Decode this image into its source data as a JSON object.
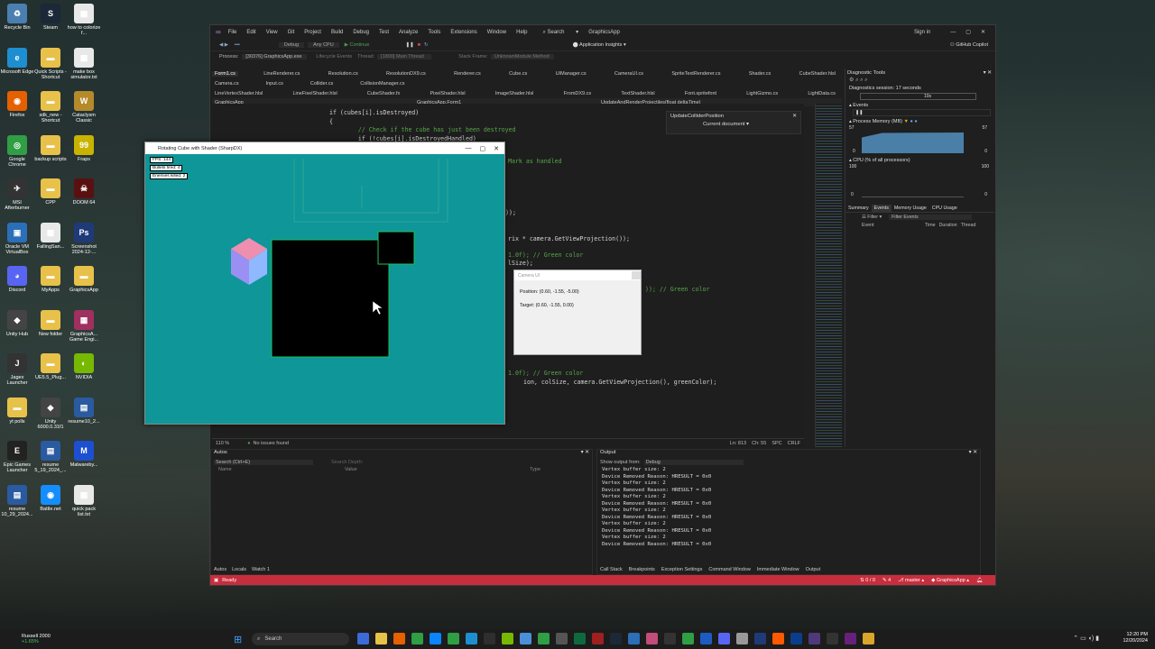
{
  "desktop": {
    "icons": [
      {
        "label": "Recycle Bin",
        "color": "#4a7fb0",
        "glyph": "♻"
      },
      {
        "label": "Steam",
        "color": "#1b2838",
        "glyph": "S"
      },
      {
        "label": "how to colorize f...",
        "color": "#e8e8e8",
        "glyph": "▦"
      },
      {
        "label": "Microsoft Edge",
        "color": "#1d8fd1",
        "glyph": "e"
      },
      {
        "label": "Quick Scripts - Shortcut",
        "color": "#e8c14a",
        "glyph": "▬"
      },
      {
        "label": "make box simulator.txt",
        "color": "#e8e8e8",
        "glyph": "▦"
      },
      {
        "label": "Firefox",
        "color": "#e66000",
        "glyph": "◉"
      },
      {
        "label": "sdk_new - Shortcut",
        "color": "#e8c14a",
        "glyph": "▬"
      },
      {
        "label": "Cataclysm Classic",
        "color": "#b58a2a",
        "glyph": "W"
      },
      {
        "label": "Google Chrome",
        "color": "#2f9e44",
        "glyph": "◎"
      },
      {
        "label": "backup scripts",
        "color": "#e8c14a",
        "glyph": "▬"
      },
      {
        "label": "Fraps",
        "color": "#c8b400",
        "glyph": "99"
      },
      {
        "label": "MSI Afterburner",
        "color": "#333",
        "glyph": "✈"
      },
      {
        "label": "CPP",
        "color": "#e8c14a",
        "glyph": "▬"
      },
      {
        "label": "DOOM 64",
        "color": "#5a1010",
        "glyph": "☠"
      },
      {
        "label": "Oracle VM VirtualBox",
        "color": "#2a6fb8",
        "glyph": "▣"
      },
      {
        "label": "FallingSan...",
        "color": "#e8e8e8",
        "glyph": "▦"
      },
      {
        "label": "Screenshot 2024-12-...",
        "color": "#1e3a78",
        "glyph": "Ps"
      },
      {
        "label": "Discord",
        "color": "#5865f2",
        "glyph": "◕"
      },
      {
        "label": "MyApps",
        "color": "#e8c14a",
        "glyph": "▬"
      },
      {
        "label": "GraphicsApp",
        "color": "#e8c14a",
        "glyph": "▬"
      },
      {
        "label": "Unity Hub",
        "color": "#444",
        "glyph": "◆"
      },
      {
        "label": "New folder",
        "color": "#e8c14a",
        "glyph": "▬"
      },
      {
        "label": "GraphicsA... Game Engi...",
        "color": "#a03060",
        "glyph": "▦"
      },
      {
        "label": "Jagex Launcher",
        "color": "#333",
        "glyph": "J"
      },
      {
        "label": "UE5.5_Plug...",
        "color": "#e8c14a",
        "glyph": "▬"
      },
      {
        "label": "NVIDIA",
        "color": "#76b900",
        "glyph": "◐"
      },
      {
        "label": "yt polls",
        "color": "#e8c14a",
        "glyph": "▬"
      },
      {
        "label": "Unity 6000.0.31f1",
        "color": "#444",
        "glyph": "◆"
      },
      {
        "label": "resume10_2...",
        "color": "#2a5aa0",
        "glyph": "▤"
      },
      {
        "label": "Epic Games Launcher",
        "color": "#222",
        "glyph": "E"
      },
      {
        "label": "resume 5_19_2024_...",
        "color": "#2a5aa0",
        "glyph": "▤"
      },
      {
        "label": "Malwareby...",
        "color": "#1d4fd1",
        "glyph": "M"
      },
      {
        "label": "resume 10_29_2024...",
        "color": "#2a5aa0",
        "glyph": "▤"
      },
      {
        "label": "Battle.net",
        "color": "#148eff",
        "glyph": "◉"
      },
      {
        "label": "quick pack list.txt",
        "color": "#e8e8e8",
        "glyph": "▦"
      }
    ]
  },
  "vs": {
    "menu": [
      "File",
      "Edit",
      "View",
      "Git",
      "Project",
      "Build",
      "Debug",
      "Test",
      "Analyze",
      "Tools",
      "Extensions",
      "Window",
      "Help"
    ],
    "search_label": "Search",
    "app_title": "GraphicsApp",
    "sign_in": "Sign in",
    "copilot": "GitHub Copilot",
    "toolbar": {
      "config": "Debug",
      "platform": "Any CPU",
      "continue": "Continue",
      "insights": "Application Insights"
    },
    "process": {
      "label": "Process:",
      "value": "[30376] GraphicsApp.exe",
      "lifecycle": "Lifecycle Events",
      "thread_label": "Thread:",
      "thread_value": "[1800] Main Thread",
      "stack_label": "Stack Frame:",
      "stack_value": "UnknownModule.Method"
    },
    "tabs_row1": [
      "Form1.cs",
      "LineRenderer.cs",
      "Resolution.cs",
      "ResolutionDX9.cs",
      "Renderer.cs",
      "Cube.cs",
      "UIManager.cs",
      "CameraUI.cs",
      "SpriteTextRenderer.cs",
      "Shader.cs",
      "CubeShader.hlsl"
    ],
    "tabs_row2": [
      "Camera.cs",
      "Input.cs",
      "Collider.cs",
      "CollisionManager.cs"
    ],
    "tabs_row3": [
      "LineVertexShader.hlsl",
      "LineFixelShader.hlsl",
      "CubeShader.fx",
      "PixelShader.hlsl",
      "ImageShader.hlsl",
      "FromDX9.cs",
      "TextShader.hlsl",
      "Font.spritefont",
      "LightGizmo.cs",
      "LightData.cs"
    ],
    "nav": {
      "project": "GraphicsApp",
      "class": "GraphicsApp.Form1",
      "member": "UpdateAndRenderProjectiles(float deltaTime)"
    },
    "peek": {
      "title": "UpdateColliderPosition",
      "scope": "Current document"
    },
    "code_lines": [
      {
        "t": "if (cubes[i].isDestroyed)",
        "c": "tx"
      },
      {
        "t": "{",
        "c": "tx"
      },
      {
        "t": "    // Check if the cube has just been destroyed",
        "c": "cm"
      },
      {
        "t": "    if (!cubes[i].isDestroyedHandled)",
        "c": "tx"
      }
    ],
    "code_right": [
      {
        "t": "Mark as handled",
        "c": "cm"
      },
      {
        "t": "));",
        "c": "tx"
      },
      {
        "t": "rix * camera.GetViewProjection());",
        "c": "tx"
      },
      {
        "t": "1.0f); // Green color",
        "c": "cm"
      },
      {
        "t": "lSize);",
        "c": "tx"
      },
      {
        "t": ")); // Green color",
        "c": "cm"
      },
      {
        "t": "1.0f); // Green color",
        "c": "cm"
      },
      {
        "t": "ion, colSize, camera.GetViewProjection(), greenColor);",
        "c": "tx"
      }
    ],
    "editor_status": {
      "zoom": "110 %",
      "issues": "No issues found",
      "ln": "Ln: 813",
      "ch": "Ch: 55",
      "spc": "SPC",
      "crlf": "CRLF"
    },
    "diag": {
      "title": "Diagnostic Tools",
      "session": "Diagnostics session: 17 seconds",
      "tick": "10s",
      "events_label": "Events",
      "memory_label": "Process Memory (MB)",
      "memory_max": "57",
      "memory_min": "0",
      "cpu_label": "CPU (% of all processors)",
      "cpu_max": "100",
      "cpu_min": "0",
      "tabs": [
        "Summary",
        "Events",
        "Memory Usage",
        "CPU Usage"
      ],
      "filter": "Filter",
      "filter_events": "Filter Events",
      "cols": [
        "Event",
        "Time",
        "Duration",
        "Thread"
      ]
    },
    "autos": {
      "title": "Autos",
      "search": "Search (Ctrl+E)",
      "depth": "Search Depth:",
      "cols": [
        "Name",
        "Value",
        "Type"
      ],
      "tabs": [
        "Autos",
        "Locals",
        "Watch 1"
      ]
    },
    "output": {
      "title": "Output",
      "show_from": "Show output from:",
      "source": "Debug",
      "lines": [
        "Vertex buffer size: 2",
        "Device Removed Reason: HRESULT = 0x0",
        "Vertex buffer size: 2",
        "Device Removed Reason: HRESULT = 0x0",
        "Vertex buffer size: 2",
        "Device Removed Reason: HRESULT = 0x0",
        "Vertex buffer size: 2",
        "Device Removed Reason: HRESULT = 0x0",
        "Vertex buffer size: 2",
        "Device Removed Reason: HRESULT = 0x0",
        "Vertex buffer size: 2",
        "Device Removed Reason: HRESULT = 0x0"
      ],
      "tabs": [
        "Call Stack",
        "Breakpoints",
        "Exception Settings",
        "Command Window",
        "Immediate Window",
        "Output"
      ]
    },
    "status": {
      "ready": "Ready",
      "arrows": "0 / 0",
      "pencil": "4",
      "branch": "master",
      "repo": "GraphicsApp"
    }
  },
  "game": {
    "title": "Rotating Cube with Shader (SharpDX)",
    "fps": "FPS: 144",
    "bullets": "Bullets fired: 4",
    "enemies": "Enemies killed: 2",
    "bg": "#0e9698"
  },
  "camera_ui": {
    "title": "Camera UI",
    "position": "Position: (0.60, -1.55, -5.00)",
    "target": "Target: (0.60, -1.55, 0.00)"
  },
  "taskbar": {
    "ticker_name": "Russell 2000",
    "ticker_change": "+1.65%",
    "search": "Search",
    "time": "12:20 PM",
    "date": "12/20/2024",
    "apps": [
      "#3c6bd9",
      "#e8c14a",
      "#e66000",
      "#2f9e44",
      "#0a84ff",
      "#2f9e44",
      "#1d8fd1",
      "#2e2e2e",
      "#76b900",
      "#4a90d9",
      "#2f9e44",
      "#555",
      "#0e6a3e",
      "#9e2020",
      "#1b2838",
      "#2a6fb8",
      "#c04d7a",
      "#333",
      "#2f9e44",
      "#1c5cc2",
      "#5865f2",
      "#999",
      "#1e3a78",
      "#ff5a00",
      "#0a3e8a",
      "#4e3a7a",
      "#333",
      "#68217a",
      "#d9a52a"
    ]
  }
}
